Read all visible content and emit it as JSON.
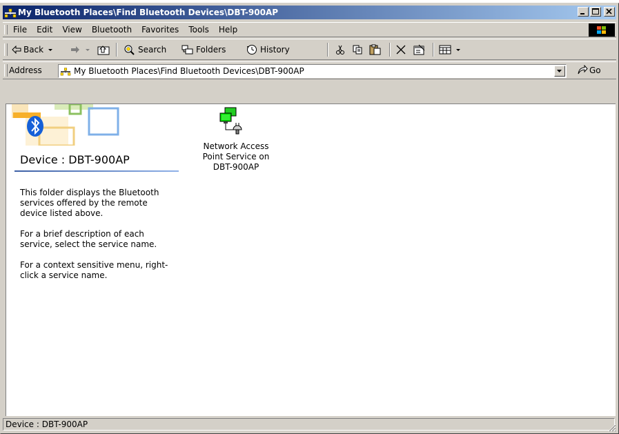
{
  "window": {
    "title": "My Bluetooth Places\\Find Bluetooth Devices\\DBT-900AP",
    "title_bar_color": "#0a246a"
  },
  "menu": [
    "File",
    "Edit",
    "View",
    "Bluetooth",
    "Favorites",
    "Tools",
    "Help"
  ],
  "toolbar": {
    "back_label": "Back",
    "search_label": "Search",
    "folders_label": "Folders",
    "history_label": "History"
  },
  "address": {
    "label": "Address",
    "value": "My Bluetooth Places\\Find Bluetooth Devices\\DBT-900AP",
    "go_label": "Go"
  },
  "left_panel": {
    "device_title": "Device : DBT-900AP",
    "paragraphs": [
      "This folder displays the Bluetooth services offered by the remote device listed above.",
      "For a brief description of each service, select the service name.",
      "For a context sensitive menu, right-click a service name."
    ]
  },
  "services": [
    {
      "label": "Network Access Point Service on DBT-900AP",
      "icon": "network-access-point-icon"
    }
  ],
  "status": {
    "text": "Device : DBT-900AP"
  }
}
